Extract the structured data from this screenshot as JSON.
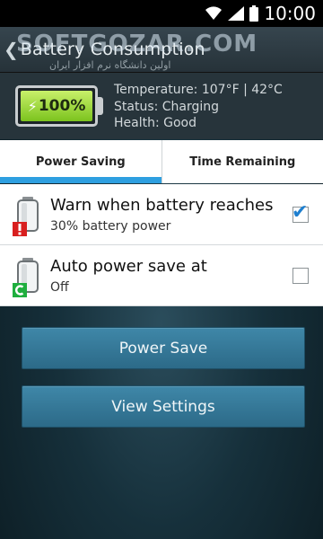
{
  "status_bar": {
    "time": "10:00",
    "icons": [
      "wifi-icon",
      "signal-icon",
      "battery-icon"
    ]
  },
  "titlebar": {
    "back_icon": "chevron-left-icon",
    "title": "Battery Consumption"
  },
  "watermark": {
    "text": "SOFTGOZAR.COM",
    "subtext": "اولین دانشگاه نرم افزار ایران"
  },
  "battery_info": {
    "level_label": "100%",
    "level_fraction": 1.0,
    "fill_color": "#7cc31e",
    "temperature": "Temperature: 107°F | 42°C",
    "status": "Status: Charging",
    "health": "Health: Good"
  },
  "tabs": [
    {
      "label": "Power Saving",
      "selected": true
    },
    {
      "label": "Time Remaining",
      "selected": false
    }
  ],
  "accent_color": "#2e9fe0",
  "settings": [
    {
      "title": "Warn when battery reaches",
      "subtitle": "30% battery power",
      "checked": true,
      "icon": "battery-warning-icon",
      "badge_color": "#d81f1f"
    },
    {
      "title": "Auto power save at",
      "subtitle": "Off",
      "checked": false,
      "icon": "battery-autosave-icon",
      "badge_color": "#1fae3e"
    }
  ],
  "buttons": {
    "power_save": "Power Save",
    "view_settings": "View Settings"
  }
}
